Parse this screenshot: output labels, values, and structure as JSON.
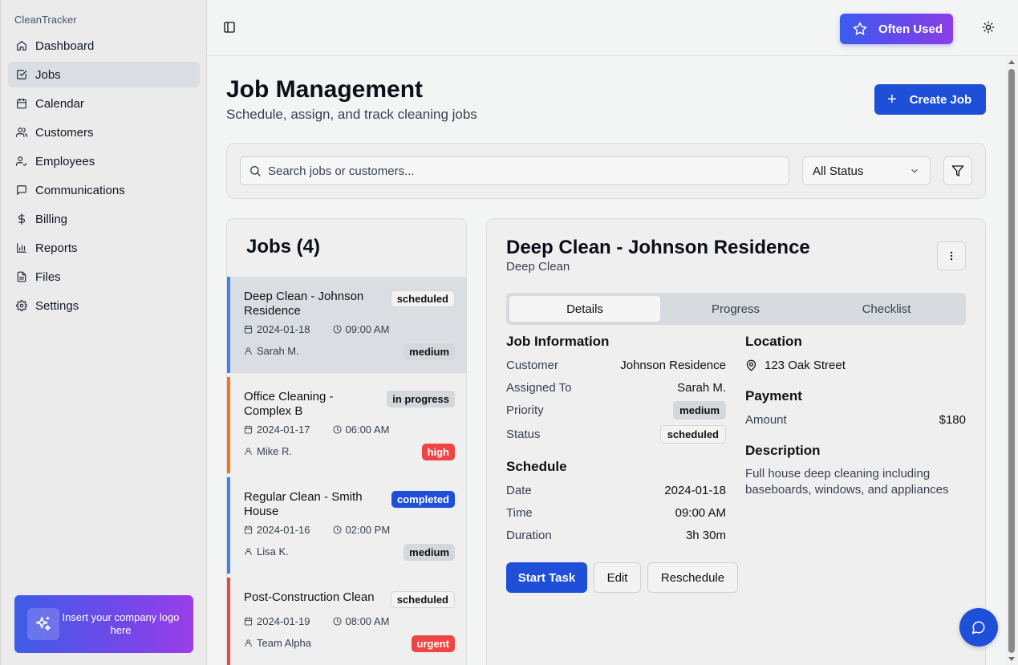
{
  "app": {
    "brand": "CleanTracker"
  },
  "sidebar": {
    "items": [
      {
        "label": "Dashboard",
        "icon": "home-icon"
      },
      {
        "label": "Jobs",
        "icon": "checkbox-icon",
        "active": true
      },
      {
        "label": "Calendar",
        "icon": "calendar-icon"
      },
      {
        "label": "Customers",
        "icon": "users-icon"
      },
      {
        "label": "Employees",
        "icon": "user-check-icon"
      },
      {
        "label": "Communications",
        "icon": "message-icon"
      },
      {
        "label": "Billing",
        "icon": "dollar-icon"
      },
      {
        "label": "Reports",
        "icon": "bar-chart-icon"
      },
      {
        "label": "Files",
        "icon": "file-icon"
      },
      {
        "label": "Settings",
        "icon": "gear-icon"
      }
    ],
    "logo_text": "Insert your company logo here"
  },
  "topbar": {
    "often_used": "Often Used"
  },
  "page": {
    "title": "Job Management",
    "subtitle": "Schedule, assign, and track cleaning jobs",
    "create_label": "Create Job"
  },
  "filters": {
    "search_placeholder": "Search jobs or customers...",
    "status_value": "All Status"
  },
  "jobs": {
    "title": "Jobs (4)",
    "items": [
      {
        "name": "Deep Clean - Johnson Residence",
        "status": "scheduled",
        "date": "2024-01-18",
        "time": "09:00 AM",
        "assignee": "Sarah M.",
        "priority": "medium",
        "accent": "#3b82f6"
      },
      {
        "name": "Office Cleaning - Complex B",
        "status": "in progress",
        "date": "2024-01-17",
        "time": "06:00 AM",
        "assignee": "Mike R.",
        "priority": "high",
        "accent": "#f97316"
      },
      {
        "name": "Regular Clean - Smith House",
        "status": "completed",
        "date": "2024-01-16",
        "time": "02:00 PM",
        "assignee": "Lisa K.",
        "priority": "medium",
        "accent": "#3b82f6"
      },
      {
        "name": "Post-Construction Clean",
        "status": "scheduled",
        "date": "2024-01-19",
        "time": "08:00 AM",
        "assignee": "Team Alpha",
        "priority": "urgent",
        "accent": "#ef4444"
      }
    ]
  },
  "detail": {
    "title": "Deep Clean - Johnson Residence",
    "type": "Deep Clean",
    "tabs": [
      "Details",
      "Progress",
      "Checklist"
    ],
    "job_info": {
      "heading": "Job Information",
      "customer_label": "Customer",
      "customer": "Johnson Residence",
      "assigned_label": "Assigned To",
      "assigned": "Sarah M.",
      "priority_label": "Priority",
      "priority": "medium",
      "status_label": "Status",
      "status": "scheduled"
    },
    "schedule": {
      "heading": "Schedule",
      "date_label": "Date",
      "date": "2024-01-18",
      "time_label": "Time",
      "time": "09:00 AM",
      "duration_label": "Duration",
      "duration": "3h 30m"
    },
    "location": {
      "heading": "Location",
      "address": "123 Oak Street"
    },
    "payment": {
      "heading": "Payment",
      "amount_label": "Amount",
      "amount": "$180"
    },
    "description": {
      "heading": "Description",
      "text": "Full house deep cleaning including baseboards, windows, and appliances"
    },
    "actions": {
      "start": "Start Task",
      "edit": "Edit",
      "reschedule": "Reschedule"
    }
  },
  "colors": {
    "primary": "#1d4fd8",
    "danger": "#ef4444",
    "warning": "#f97316"
  }
}
